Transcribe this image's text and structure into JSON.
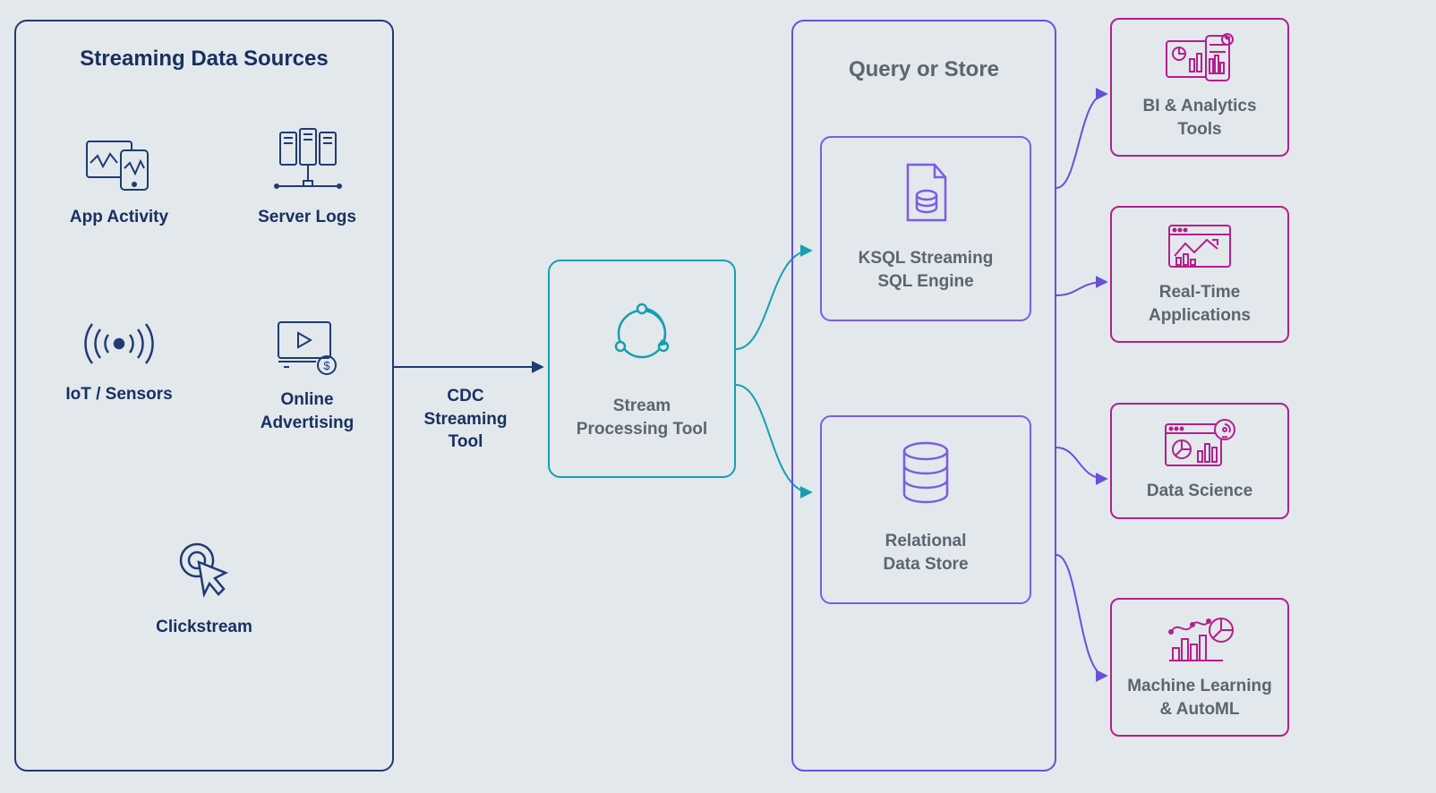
{
  "sources": {
    "title": "Streaming Data Sources",
    "items": {
      "app": "App Activity",
      "logs": "Server Logs",
      "iot": "IoT / Sensors",
      "ads": "Online\nAdvertising",
      "click": "Clickstream"
    }
  },
  "cdc": "CDC\nStreaming\nTool",
  "stream": "Stream\nProcessing Tool",
  "query": {
    "title": "Query or Store",
    "ksql": "KSQL Streaming\nSQL Engine",
    "rds": "Relational\nData Store"
  },
  "dest": {
    "bi": "BI & Analytics\nTools",
    "rt": "Real-Time\nApplications",
    "ds": "Data Science",
    "ml": "Machine Learning\n& AutoML"
  },
  "colors": {
    "navy": "#1f3b73",
    "teal": "#159fb0",
    "purple": "#6a4fd9",
    "magenta": "#b61e8c"
  }
}
